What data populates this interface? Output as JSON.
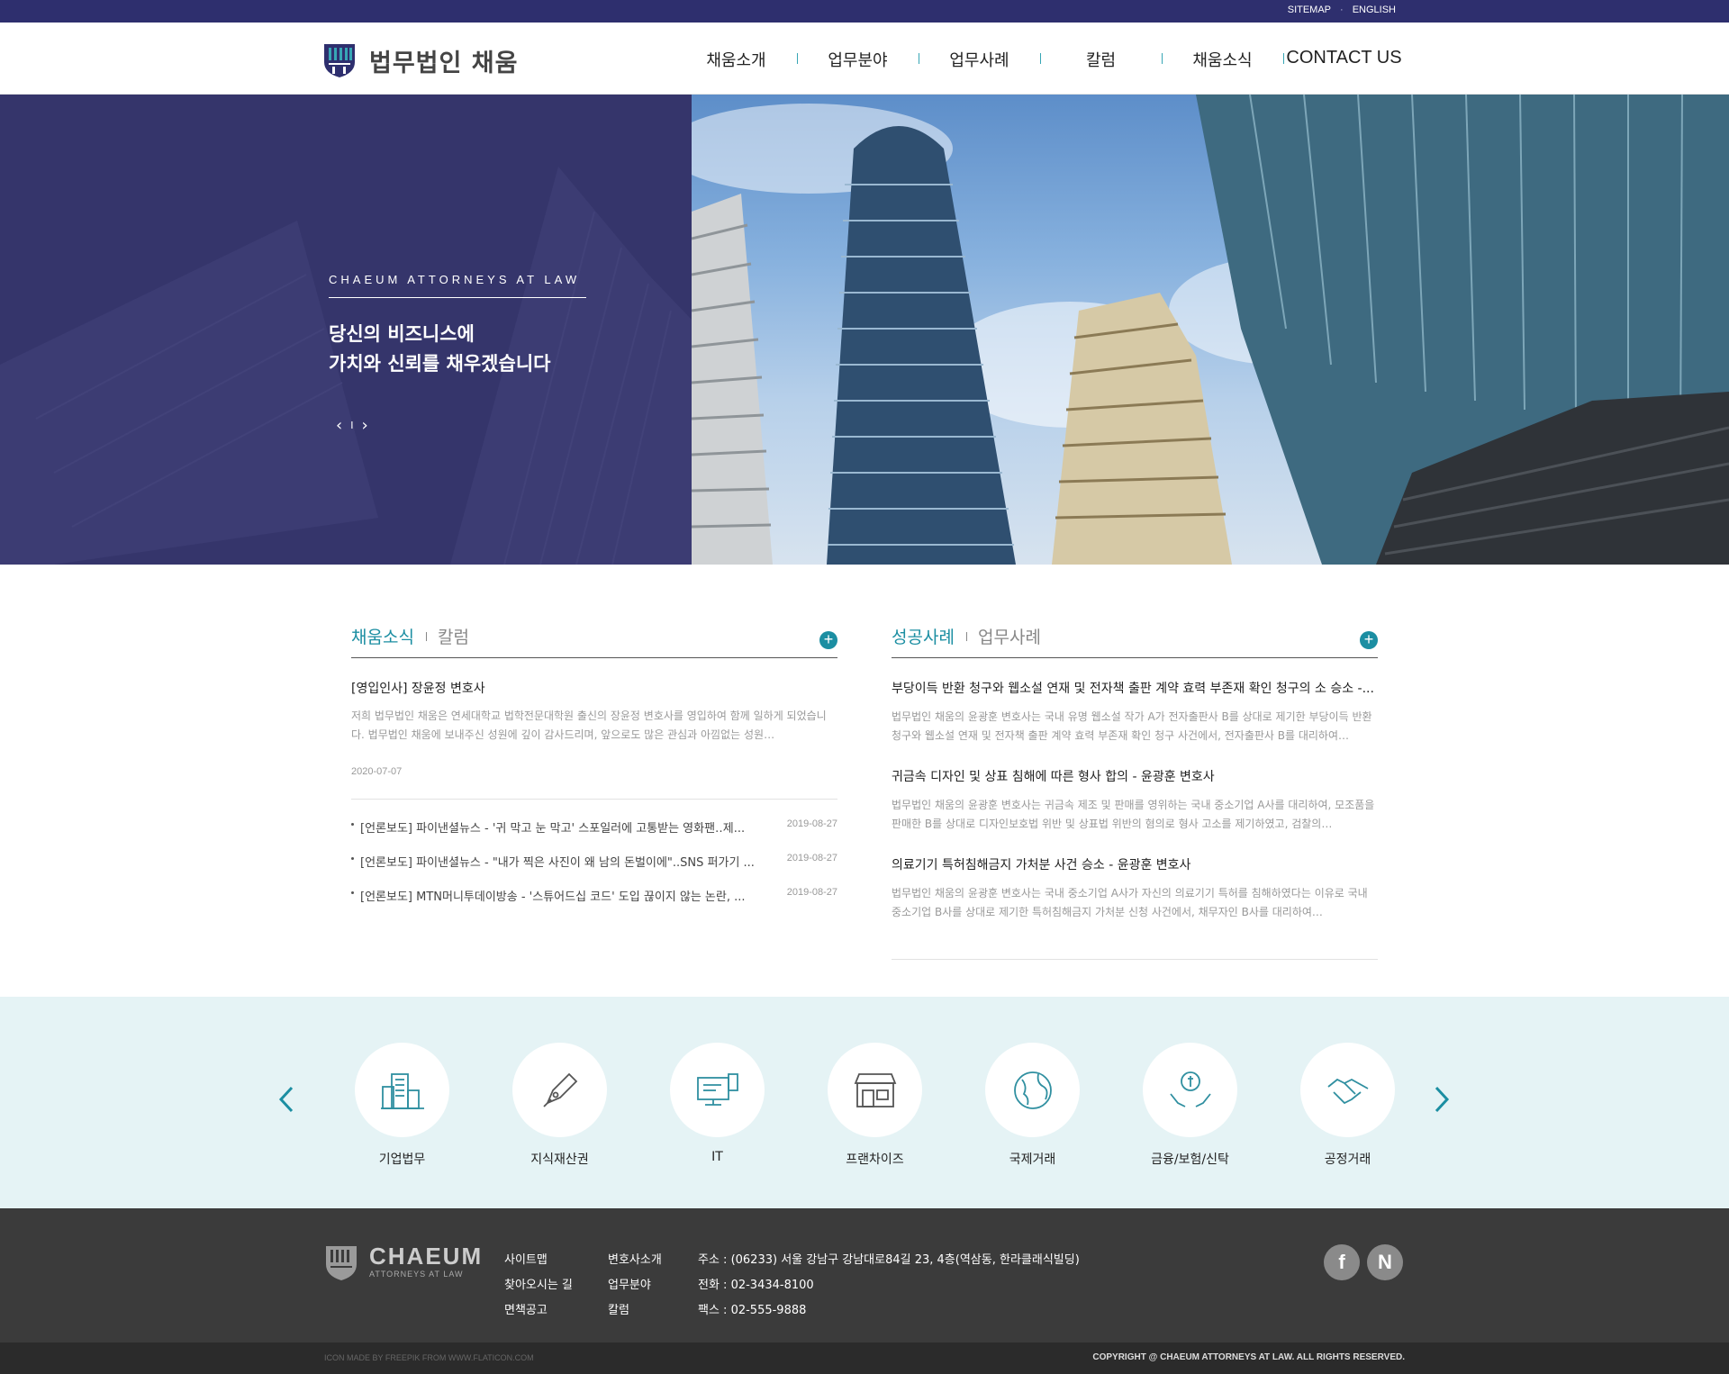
{
  "topbar": {
    "sitemap": "SITEMAP",
    "separator": "·",
    "english": "ENGLISH"
  },
  "header": {
    "logo_text": "법무법인 채움",
    "nav": [
      "채움소개",
      "업무분야",
      "업무사례",
      "칼럼",
      "채움소식",
      "CONTACT US"
    ]
  },
  "hero": {
    "eyebrow": "CHAEUM ATTORNEYS AT LAW",
    "title_line1": "당신의 비즈니스에",
    "title_line2": "가치와 신뢰를 채우겠습니다",
    "prev": "‹",
    "divider": "I",
    "next": "›"
  },
  "news_board": {
    "tab_active": "채움소식",
    "tab_inactive": "칼럼",
    "more": "+",
    "feature": {
      "title": "[영입인사] 장윤정 변호사",
      "desc": "저희 법무법인 채움은 연세대학교 법학전문대학원 출신의 장윤정 변호사를 영입하여 함께 일하게 되었습니다. 법무법인 채움에 보내주신 성원에 깊이 감사드리며, 앞으로도 많은 관심과 아낌없는 성원…",
      "date": "2020-07-07"
    },
    "items": [
      {
        "title": "[언론보도] 파이낸셜뉴스 - '귀 막고 눈 막고' 스포일러에 고통받는 영화팬‥제...",
        "date": "2019-08-27"
      },
      {
        "title": "[언론보도] 파이낸셜뉴스 - \"내가 찍은 사진이 왜 남의 돈벌이에\"..SNS 퍼가기 ...",
        "date": "2019-08-27"
      },
      {
        "title": "[언론보도] MTN머니투데이방송 - '스튜어드십 코드' 도입 끊이지 않는 논란, ...",
        "date": "2019-08-27"
      }
    ]
  },
  "case_board": {
    "tab_active": "성공사례",
    "tab_inactive": "업무사례",
    "more": "+",
    "items": [
      {
        "title": "부당이득 반환 청구와 웹소설 연재 및 전자책 출판 계약 효력 부존재 확인 청구의 소 승소 -...",
        "desc": "법무법인 채움의 윤광훈 변호사는 국내 유명 웹소설 작가 A가 전자출판사 B를 상대로 제기한 부당이득 반환 청구와 웹소설 연재 및 전자책 출판 계약 효력 부존재 확인 청구 사건에서, 전자출판사 B를 대리하여…"
      },
      {
        "title": "귀금속 디자인 및 상표 침해에 따른 형사 합의 - 윤광훈 변호사",
        "desc": "법무법인 채움의 윤광훈 변호사는 귀금속 제조 및 판매를 영위하는 국내 중소기업 A사를 대리하여, 모조품을 판매한 B를 상대로 디자인보호법 위반 및 상표법 위반의 혐의로 형사 고소를 제기하였고, 검찰의…"
      },
      {
        "title": "의료기기 특허침해금지 가처분 사건 승소 - 윤광훈 변호사",
        "desc": "법무법인 채움의 윤광훈 변호사는 국내 중소기업 A사가 자신의 의료기기 특허를 침해하였다는 이유로 국내 중소기업 B사를 상대로 제기한 특허침해금지 가처분 신청 사건에서, 채무자인 B사를 대리하여…"
      }
    ]
  },
  "practice": {
    "areas": [
      {
        "label": "기업법무",
        "icon": "building-icon"
      },
      {
        "label": "지식재산권",
        "icon": "pen-nib-icon"
      },
      {
        "label": "IT",
        "icon": "computer-icon"
      },
      {
        "label": "프랜차이즈",
        "icon": "storefront-icon"
      },
      {
        "label": "국제거래",
        "icon": "globe-icon"
      },
      {
        "label": "금융/보험/신탁",
        "icon": "money-hands-icon"
      },
      {
        "label": "공정거래",
        "icon": "handshake-icon"
      }
    ]
  },
  "footer": {
    "logo_name": "CHAEUM",
    "logo_sub": "ATTORNEYS AT LAW",
    "col1": [
      "사이트맵",
      "찾아오시는 길",
      "면책공고"
    ],
    "col2": [
      "변호사소개",
      "업무분야",
      "칼럼"
    ],
    "address": "주소 : (06233) 서울 강남구 강남대로84길 23, 4층(역삼동, 한라클래식빌딩)",
    "phone": "전화 : 02-3434-8100",
    "fax": "팩스 : 02-555-9888",
    "sns": [
      "f",
      "N"
    ],
    "credit": "ICON MADE BY FREEPIK FROM WWW.FLATICON.COM",
    "copyright": "COPYRIGHT @ CHAEUM ATTORNEYS AT LAW. ALL RIGHTS RESERVED."
  },
  "colors": {
    "navy": "#2e2f6e",
    "teal": "#1b8ea2",
    "mint_bg": "#e5f3f5",
    "footer": "#3b3b3b"
  }
}
